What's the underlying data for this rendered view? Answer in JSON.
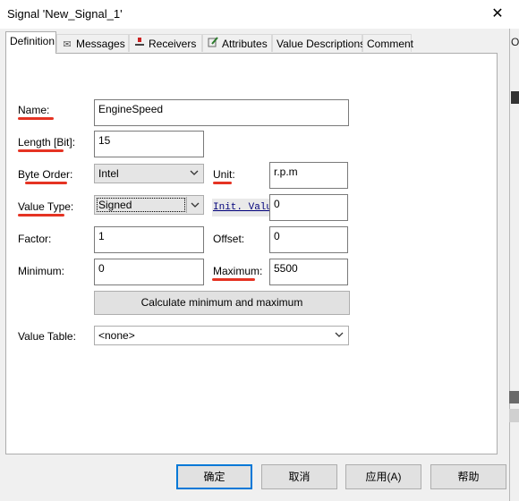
{
  "window": {
    "title": "Signal 'New_Signal_1'",
    "close_glyph": "✕"
  },
  "background_fragment": "Of",
  "tabs": [
    {
      "label": "Definition",
      "icon": "",
      "active": true
    },
    {
      "label": "Messages",
      "icon": "envelope-icon",
      "active": false
    },
    {
      "label": "Receivers",
      "icon": "receiver-icon",
      "active": false
    },
    {
      "label": "Attributes",
      "icon": "attributes-icon",
      "active": false
    },
    {
      "label": "Value Descriptions",
      "icon": "",
      "active": false
    },
    {
      "label": "Comment",
      "icon": "",
      "active": false
    }
  ],
  "form": {
    "name": {
      "label": "Name:",
      "value": "EngineSpeed"
    },
    "length": {
      "label": "Length [Bit]:",
      "value": "15"
    },
    "byte_order": {
      "label": "Byte Order:",
      "value": "Intel"
    },
    "unit": {
      "label": "Unit:",
      "value": "r.p.m"
    },
    "value_type": {
      "label": "Value Type:",
      "value": "Signed"
    },
    "init_value": {
      "label": "Init. Value",
      "value": "0"
    },
    "factor": {
      "label": "Factor:",
      "value": "1"
    },
    "offset": {
      "label": "Offset:",
      "value": "0"
    },
    "minimum": {
      "label": "Minimum:",
      "value": "0"
    },
    "maximum": {
      "label": "Maximum:",
      "value": "5500"
    },
    "calc_button": "Calculate minimum and maximum",
    "value_table": {
      "label": "Value Table:",
      "value": "<none>"
    }
  },
  "annotation_color": "#e53323",
  "footer": {
    "ok": "确定",
    "cancel": "取消",
    "apply": "应用(A)",
    "help": "帮助"
  }
}
